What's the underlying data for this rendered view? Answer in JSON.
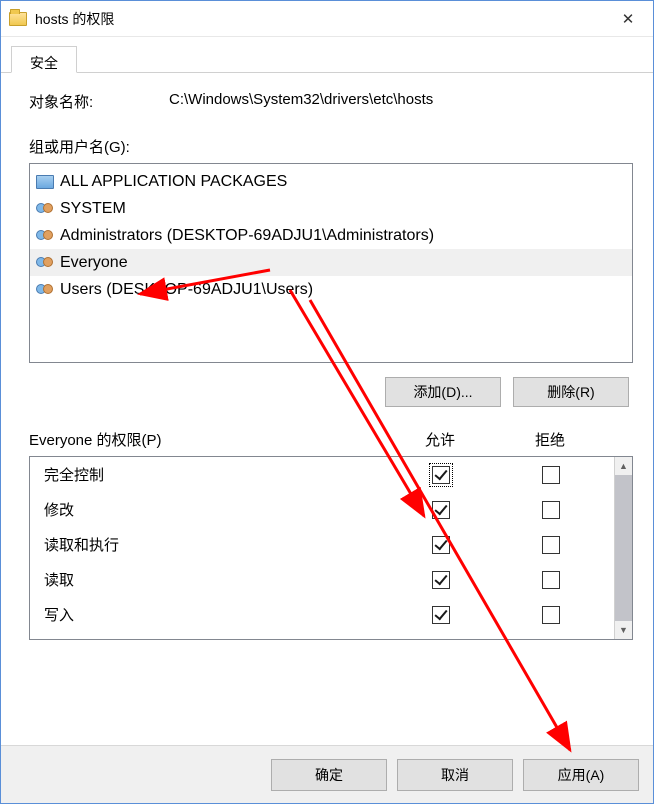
{
  "window": {
    "title": "hosts 的权限",
    "close_glyph": "✕"
  },
  "tabs": [
    {
      "label": "安全"
    }
  ],
  "object_row": {
    "label": "对象名称:",
    "value": "C:\\Windows\\System32\\drivers\\etc\\hosts"
  },
  "users_section": {
    "label": "组或用户名(G):",
    "items": [
      {
        "name": "ALL APPLICATION PACKAGES",
        "icon": "package",
        "selected": false
      },
      {
        "name": "SYSTEM",
        "icon": "group",
        "selected": false
      },
      {
        "name": "Administrators (DESKTOP-69ADJU1\\Administrators)",
        "icon": "group",
        "selected": false
      },
      {
        "name": "Everyone",
        "icon": "group",
        "selected": true
      },
      {
        "name": "Users (DESKTOP-69ADJU1\\Users)",
        "icon": "group",
        "selected": false
      }
    ],
    "add_button": "添加(D)...",
    "remove_button": "删除(R)"
  },
  "permissions_section": {
    "header_for": "Everyone 的权限(P)",
    "allow_label": "允许",
    "deny_label": "拒绝",
    "rows": [
      {
        "name": "完全控制",
        "allow": true,
        "deny": false,
        "focused": true
      },
      {
        "name": "修改",
        "allow": true,
        "deny": false
      },
      {
        "name": "读取和执行",
        "allow": true,
        "deny": false
      },
      {
        "name": "读取",
        "allow": true,
        "deny": false
      },
      {
        "name": "写入",
        "allow": true,
        "deny": false
      }
    ]
  },
  "dialog_buttons": {
    "ok": "确定",
    "cancel": "取消",
    "apply": "应用(A)"
  },
  "annotation": {
    "color": "#ff0000"
  }
}
